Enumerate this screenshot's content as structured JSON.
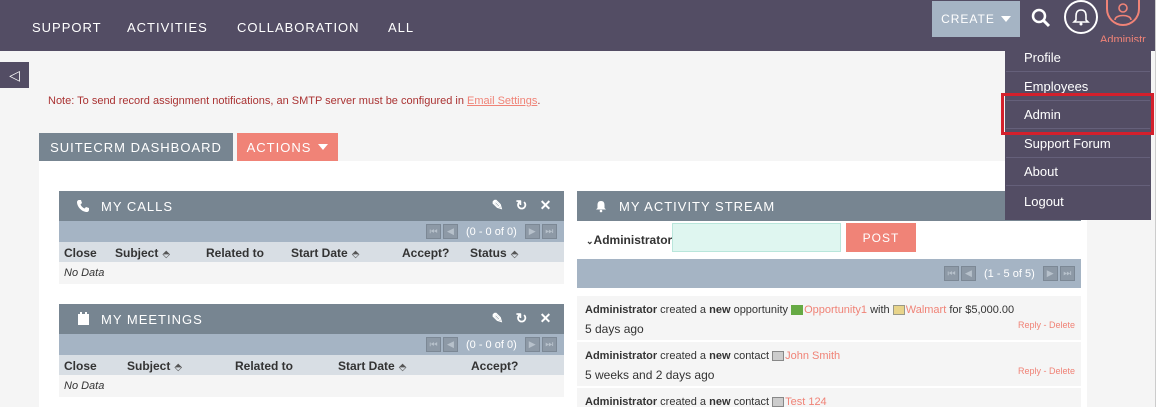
{
  "nav": {
    "items": [
      "SUPPORT",
      "ACTIVITIES",
      "COLLABORATION",
      "ALL"
    ],
    "create_label": "CREATE",
    "user_label": "Administr",
    "icons": {
      "search": "search-icon",
      "bell": "bell-icon",
      "user": "user-icon"
    }
  },
  "side_toggle": "◁",
  "note": {
    "text": "Note: To send record assignment notifications, an SMTP server must be configured in ",
    "link": "Email Settings",
    "suffix": "."
  },
  "tabs": {
    "dashboard": "SUITECRM DASHBOARD",
    "actions": "ACTIONS"
  },
  "my_calls": {
    "title": "MY CALLS",
    "pager_text": "(0 - 0 of 0)",
    "columns": [
      "Close",
      "Subject",
      "Related to",
      "Start Date",
      "Accept?",
      "Status"
    ],
    "empty": "No Data"
  },
  "my_meetings": {
    "title": "MY MEETINGS",
    "pager_text": "(0 - 0 of 0)",
    "columns": [
      "Close",
      "Subject",
      "Related to",
      "Start Date",
      "Accept?"
    ],
    "empty": "No Data"
  },
  "activity_stream": {
    "title": "MY ACTIVITY STREAM",
    "post_label": "Administrator",
    "post_button": "POST",
    "pager_text": "(1 - 5 of 5)",
    "items": [
      {
        "actor": "Administrator",
        "action": " created a ",
        "new_word": "new",
        "object_type": " opportunity ",
        "object": "Opportunity1",
        "with_text": " with ",
        "related": "Walmart",
        "extra": " for $5,000.00",
        "time": "5 days ago",
        "reply": "Reply",
        "delete": "Delete"
      },
      {
        "actor": "Administrator",
        "action": " created a ",
        "new_word": "new",
        "object_type": " contact ",
        "object": "John Smith",
        "time": "5 weeks and 2 days ago",
        "reply": "Reply",
        "delete": "Delete"
      },
      {
        "actor": "Administrator",
        "action": " created a ",
        "new_word": "new",
        "object_type": " contact ",
        "object": "Test 124"
      }
    ]
  },
  "user_menu": {
    "items": [
      "Profile",
      "Employees",
      "Admin",
      "Support Forum",
      "About",
      "Logout"
    ],
    "highlighted": "Admin"
  },
  "colors": {
    "topbar": "#534d64",
    "accent": "#f08377",
    "dashlet_header": "#778591",
    "pager": "#a5b4c4",
    "highlight": "#d4202c"
  }
}
